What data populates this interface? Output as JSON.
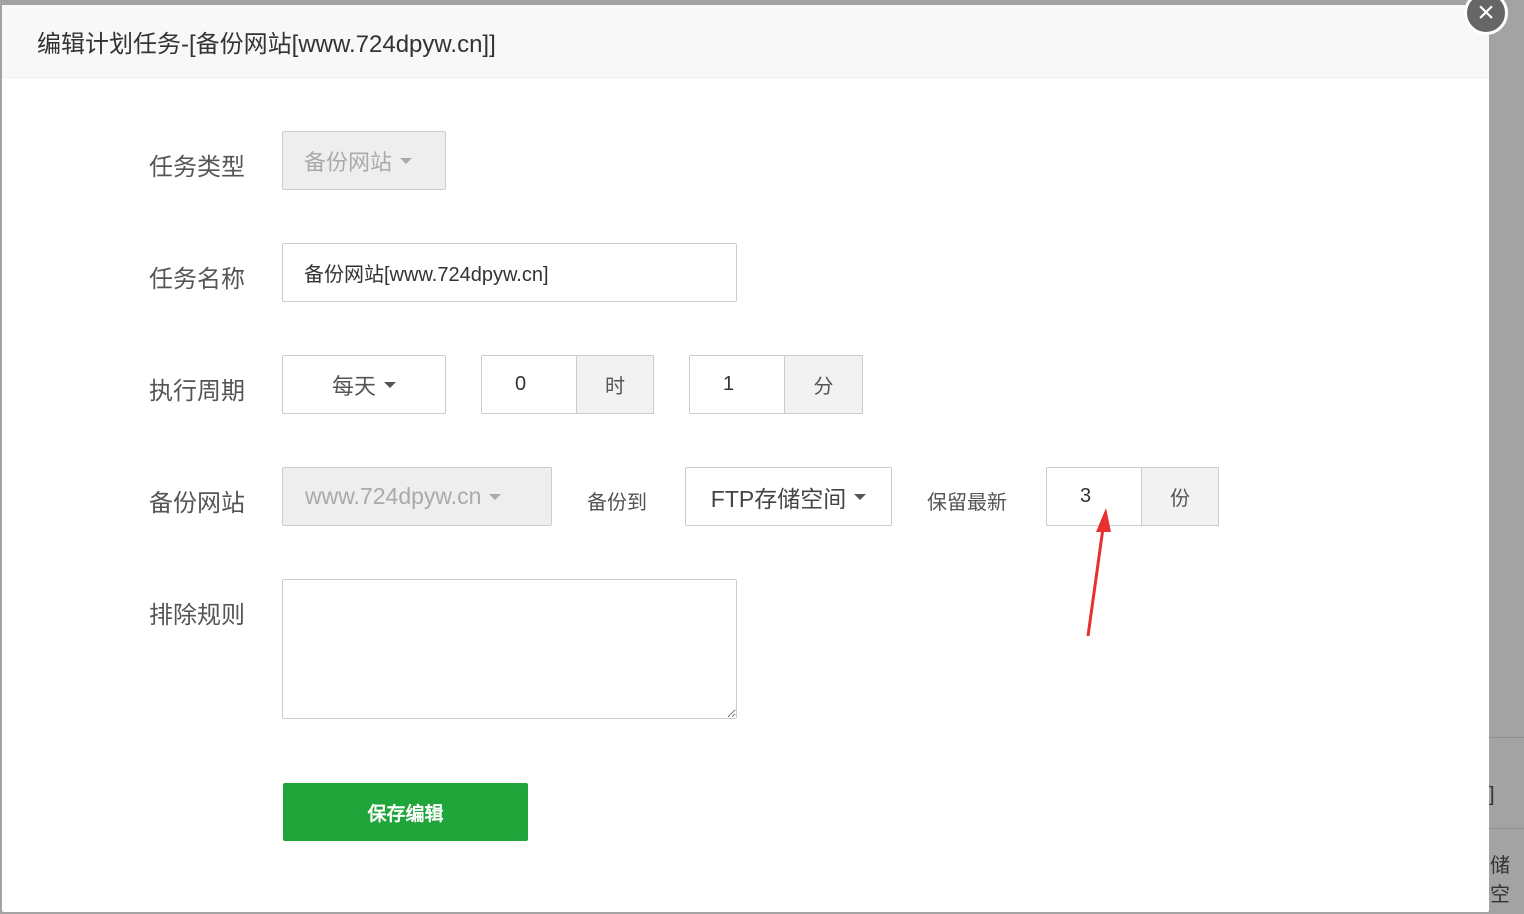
{
  "background": {
    "fragment1": "]",
    "fragment2": "储空"
  },
  "dialog": {
    "title": "编辑计划任务-[备份网站[www.724dpyw.cn]]"
  },
  "form": {
    "task_type": {
      "label": "任务类型",
      "value": "备份网站"
    },
    "task_name": {
      "label": "任务名称",
      "value": "备份网站[www.724dpyw.cn]"
    },
    "cycle": {
      "label": "执行周期",
      "period": "每天",
      "hour": "0",
      "hour_unit": "时",
      "minute": "1",
      "minute_unit": "分"
    },
    "backup_site": {
      "label": "备份网站",
      "value": "www.724dpyw.cn",
      "backup_to_label": "备份到",
      "backup_to": "FTP存储空间",
      "keep_label": "保留最新",
      "keep": "3",
      "keep_unit": "份"
    },
    "exclude": {
      "label": "排除规则",
      "value": ""
    },
    "save_label": "保存编辑"
  },
  "colors": {
    "accent": "#20a53a",
    "arrow": "#e8302f"
  }
}
